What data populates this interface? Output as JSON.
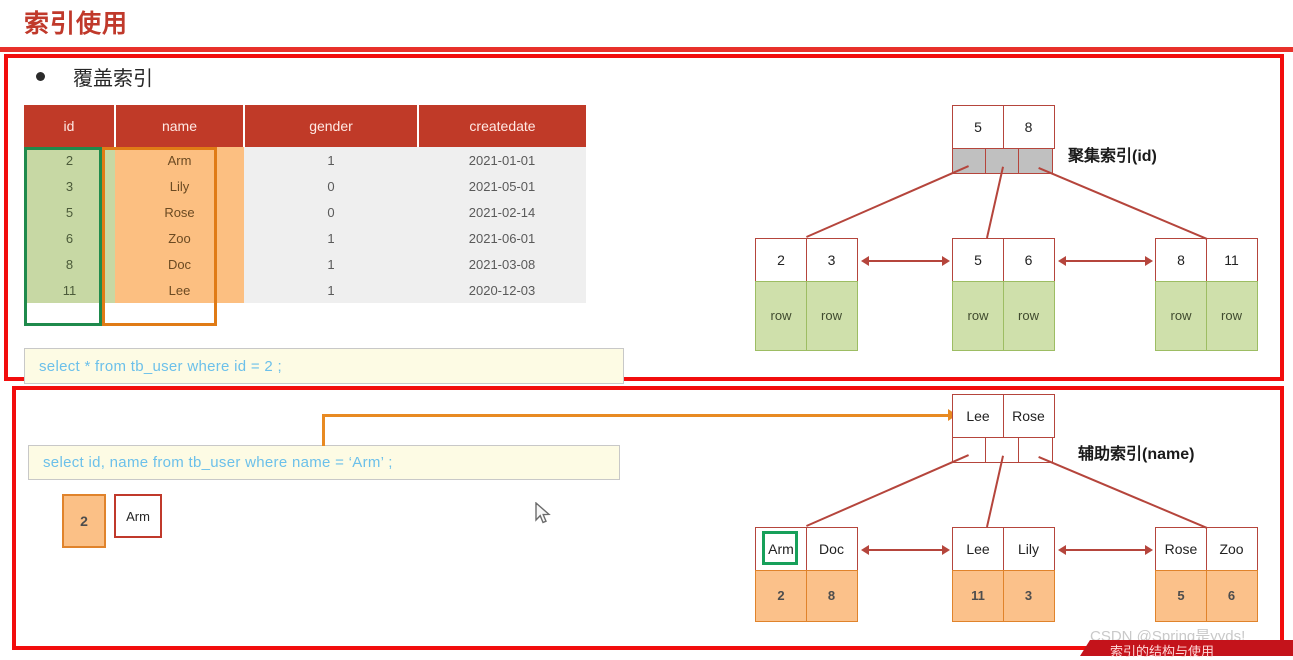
{
  "slide": {
    "title": "索引使用",
    "bullet": "覆盖索引"
  },
  "table": {
    "headers": [
      "id",
      "name",
      "gender",
      "createdate"
    ],
    "rows": [
      {
        "id": "2",
        "name": "Arm",
        "gender": "1",
        "createdate": "2021-01-01"
      },
      {
        "id": "3",
        "name": "Lily",
        "gender": "0",
        "createdate": "2021-05-01"
      },
      {
        "id": "5",
        "name": "Rose",
        "gender": "0",
        "createdate": "2021-02-14"
      },
      {
        "id": "6",
        "name": "Zoo",
        "gender": "1",
        "createdate": "2021-06-01"
      },
      {
        "id": "8",
        "name": "Doc",
        "gender": "1",
        "createdate": "2021-03-08"
      },
      {
        "id": "11",
        "name": "Lee",
        "gender": "1",
        "createdate": "2020-12-03"
      }
    ],
    "highlight_id_color": "#1f8a4c",
    "highlight_name_color": "#e07b16",
    "header_bg": "#c03a28",
    "id_bg": "#c7d8a4",
    "name_bg": "#fcbf81"
  },
  "sql": {
    "top": "select * from tb_user where id = 2 ;",
    "bottom": "select id, name from tb_user where name = ‘Arm’ ;"
  },
  "result": {
    "id": "2",
    "name": "Arm"
  },
  "clustered_index": {
    "label": "聚集索引(id)",
    "root_keys": [
      "5",
      "8"
    ],
    "root_pointers": [
      "",
      "",
      ""
    ],
    "leaves": [
      {
        "keys": [
          "2",
          "3"
        ],
        "data": [
          "row",
          "row"
        ]
      },
      {
        "keys": [
          "5",
          "6"
        ],
        "data": [
          "row",
          "row"
        ]
      },
      {
        "keys": [
          "8",
          "11"
        ],
        "data": [
          "row",
          "row"
        ]
      }
    ]
  },
  "secondary_index": {
    "label": "辅助索引(name)",
    "root_keys": [
      "Lee",
      "Rose"
    ],
    "root_pointers": [
      "",
      "",
      ""
    ],
    "leaves": [
      {
        "keys": [
          "Arm",
          "Doc"
        ],
        "data": [
          "2",
          "8"
        ]
      },
      {
        "keys": [
          "Lee",
          "Lily"
        ],
        "data": [
          "11",
          "3"
        ]
      },
      {
        "keys": [
          "Rose",
          "Zoo"
        ],
        "data": [
          "5",
          "6"
        ]
      }
    ]
  },
  "watermark": {
    "text": "CSDN @Spring是yyds!",
    "banner": "索引的结构与使用"
  },
  "colors": {
    "title": "#c0392b",
    "redbox": "#f20d0d",
    "tree_line": "#b5453c",
    "orange_arrow": "#e88a22"
  }
}
